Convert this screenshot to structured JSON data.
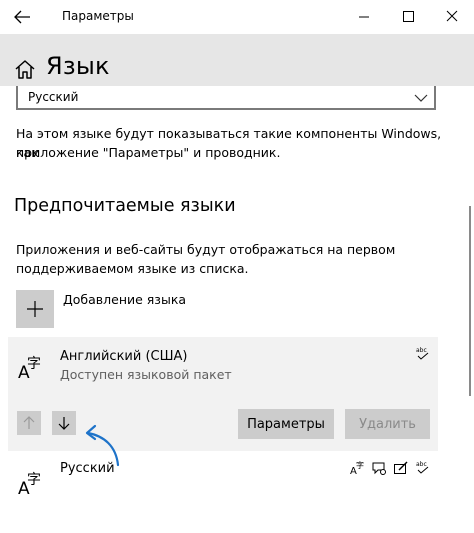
{
  "window": {
    "title": "Параметры",
    "controls": [
      "minimize-icon",
      "maximize-icon",
      "close-icon"
    ]
  },
  "header": {
    "title": "Язык",
    "icon": "home-icon"
  },
  "display_language": {
    "selected": "Русский",
    "description": [
      "На этом языке будут показываться такие компоненты Windows, как",
      "приложение \"Параметры\" и проводник."
    ]
  },
  "preferred": {
    "heading": "Предпочитаемые языки",
    "description": [
      "Приложения и веб-сайты будут отображаться на первом",
      "поддерживаемом языке из списка."
    ],
    "add_label": "Добавление языка",
    "languages": [
      {
        "name": "Английский (США)",
        "status": "Доступен языковой пакет",
        "features": [
          "spelling-icon"
        ],
        "expanded": true,
        "buttons": {
          "options": "Параметры",
          "remove": "Удалить"
        }
      },
      {
        "name": "Русский",
        "features": [
          "display-language-icon",
          "speech-icon",
          "handwriting-icon",
          "spelling-icon"
        ]
      }
    ]
  },
  "colors": {
    "annotation_arrow": "#1e73c9",
    "selected_bg": "#f2f2f2",
    "button_bg": "#cccccc",
    "header_bg": "#e6e6e6"
  }
}
